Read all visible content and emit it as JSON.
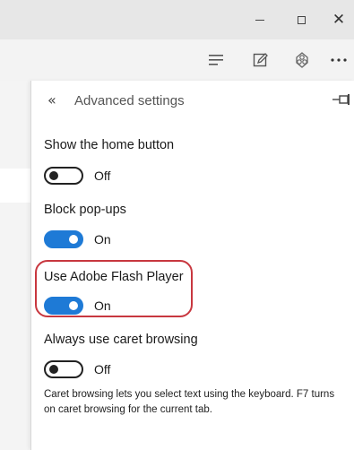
{
  "window": {
    "controls": {
      "minimize": "minimize-icon",
      "maximize": "maximize-icon",
      "close": "close-icon"
    }
  },
  "toolbar": {
    "icons": [
      "hub-icon",
      "web-note-icon",
      "share-icon",
      "more-icon"
    ]
  },
  "panel": {
    "title": "Advanced settings",
    "back_icon": "«",
    "pin_icon": "pin-icon"
  },
  "settings": [
    {
      "label": "Show the home button",
      "state": "Off",
      "on": false
    },
    {
      "label": "Block pop-ups",
      "state": "On",
      "on": true
    },
    {
      "label": "Use Adobe Flash Player",
      "state": "On",
      "on": true
    },
    {
      "label": "Always use caret browsing",
      "state": "Off",
      "on": false
    }
  ],
  "caret_description": "Caret browsing lets you select text using the keyboard. F7 turns on caret browsing for the current tab.",
  "colors": {
    "toggle_on": "#1e7ad6",
    "highlight": "#c8373f",
    "titlebar": "#e7e7e7",
    "toolbar": "#f3f3f3"
  }
}
